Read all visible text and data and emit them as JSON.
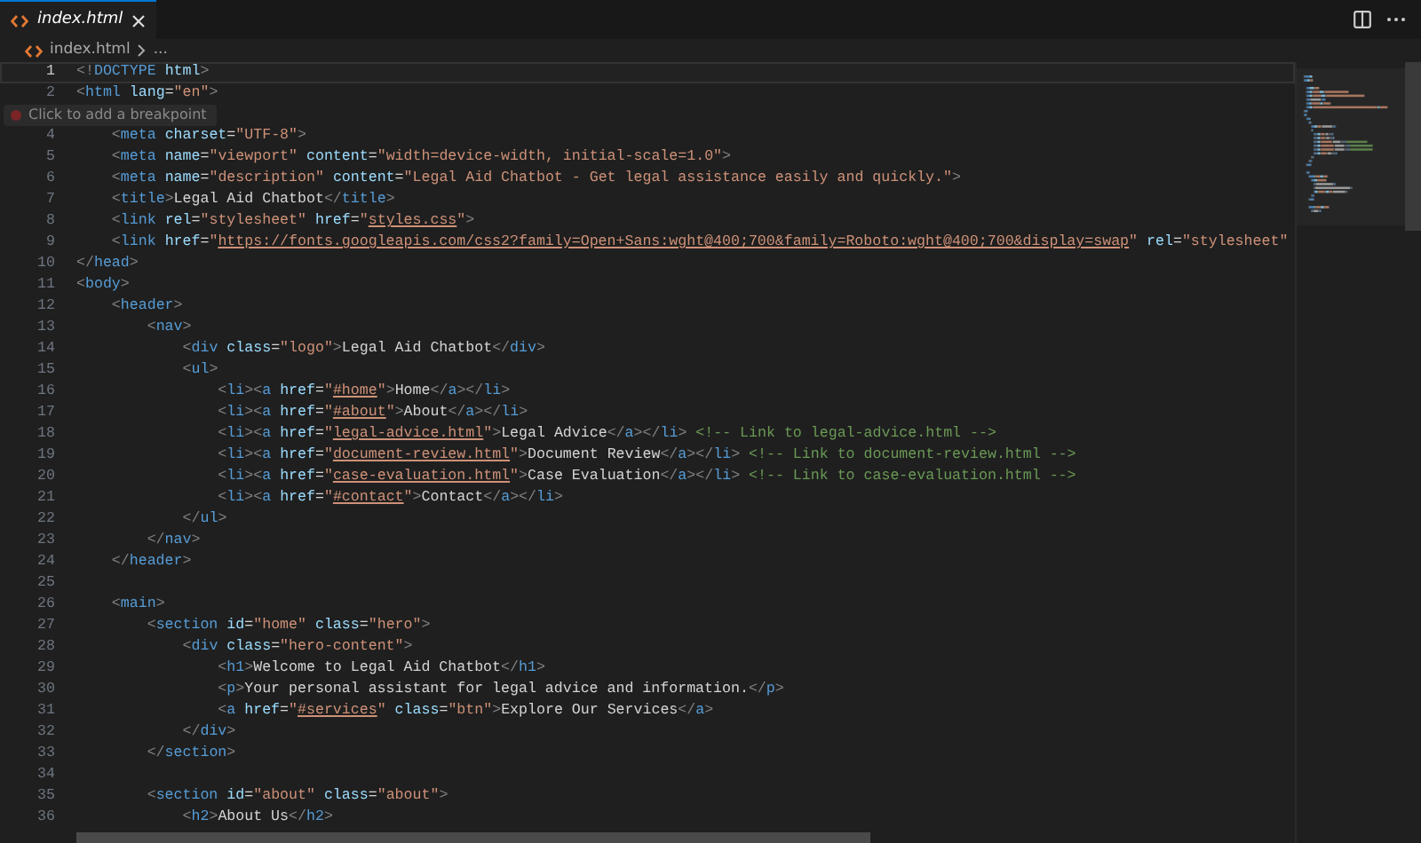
{
  "tabs": [
    {
      "label": "index.html",
      "selected": true
    }
  ],
  "breadcrumb": {
    "file": "index.html",
    "more": "..."
  },
  "editor": {
    "lines": [
      {
        "number": "1",
        "current": true,
        "tokens": [
          {
            "kind": "p",
            "text": "<!"
          },
          {
            "kind": "t",
            "text": "DOCTYPE "
          },
          {
            "kind": "a",
            "text": "html"
          },
          {
            "kind": "p",
            "text": ">"
          }
        ]
      },
      {
        "number": "2",
        "current": false,
        "tokens": [
          {
            "kind": "p",
            "text": "<"
          },
          {
            "kind": "t",
            "text": "html "
          },
          {
            "kind": "a",
            "text": "lang"
          },
          {
            "kind": "x",
            "text": "="
          },
          {
            "kind": "s",
            "text": "\"en\""
          },
          {
            "kind": "p",
            "text": ">"
          }
        ]
      },
      {
        "tooltip": "Click to add a breakpoint",
        "current": false
      },
      {
        "number": "4",
        "current": false,
        "tokens": [
          {
            "kind": "p",
            "text": "    <"
          },
          {
            "kind": "t",
            "text": "meta "
          },
          {
            "kind": "a",
            "text": "charset"
          },
          {
            "kind": "x",
            "text": "="
          },
          {
            "kind": "s",
            "text": "\"UTF-8\""
          },
          {
            "kind": "p",
            "text": ">"
          }
        ]
      },
      {
        "number": "5",
        "current": false,
        "tokens": [
          {
            "kind": "p",
            "text": "    <"
          },
          {
            "kind": "t",
            "text": "meta "
          },
          {
            "kind": "a",
            "text": "name"
          },
          {
            "kind": "x",
            "text": "="
          },
          {
            "kind": "s",
            "text": "\"viewport\" "
          },
          {
            "kind": "a",
            "text": "content"
          },
          {
            "kind": "x",
            "text": "="
          },
          {
            "kind": "s",
            "text": "\"width=device-width, initial-scale=1.0\""
          },
          {
            "kind": "p",
            "text": ">"
          }
        ]
      },
      {
        "number": "6",
        "current": false,
        "tokens": [
          {
            "kind": "p",
            "text": "    <"
          },
          {
            "kind": "t",
            "text": "meta "
          },
          {
            "kind": "a",
            "text": "name"
          },
          {
            "kind": "x",
            "text": "="
          },
          {
            "kind": "s",
            "text": "\"description\" "
          },
          {
            "kind": "a",
            "text": "content"
          },
          {
            "kind": "x",
            "text": "="
          },
          {
            "kind": "s",
            "text": "\"Legal Aid Chatbot - Get legal assistance easily and quickly.\""
          },
          {
            "kind": "p",
            "text": ">"
          }
        ]
      },
      {
        "number": "7",
        "current": false,
        "tokens": [
          {
            "kind": "p",
            "text": "    <"
          },
          {
            "kind": "t",
            "text": "title"
          },
          {
            "kind": "p",
            "text": ">"
          },
          {
            "kind": "x",
            "text": "Legal Aid Chatbot"
          },
          {
            "kind": "p",
            "text": "</"
          },
          {
            "kind": "t",
            "text": "title"
          },
          {
            "kind": "p",
            "text": ">"
          }
        ]
      },
      {
        "number": "8",
        "current": false,
        "tokens": [
          {
            "kind": "p",
            "text": "    <"
          },
          {
            "kind": "t",
            "text": "link "
          },
          {
            "kind": "a",
            "text": "rel"
          },
          {
            "kind": "x",
            "text": "="
          },
          {
            "kind": "s",
            "text": "\"stylesheet\" "
          },
          {
            "kind": "a",
            "text": "href"
          },
          {
            "kind": "x",
            "text": "="
          },
          {
            "kind": "s",
            "text": "\""
          },
          {
            "kind": "l",
            "text": "styles.css"
          },
          {
            "kind": "s",
            "text": "\""
          },
          {
            "kind": "p",
            "text": ">"
          }
        ]
      },
      {
        "number": "9",
        "current": false,
        "tokens": [
          {
            "kind": "p",
            "text": "    <"
          },
          {
            "kind": "t",
            "text": "link "
          },
          {
            "kind": "a",
            "text": "href"
          },
          {
            "kind": "x",
            "text": "="
          },
          {
            "kind": "s",
            "text": "\""
          },
          {
            "kind": "l",
            "text": "https://fonts.googleapis.com/css2?family=Open+Sans:wght@400;700&family=Roboto:wght@400;700&display=swap"
          },
          {
            "kind": "s",
            "text": "\" "
          },
          {
            "kind": "a",
            "text": "rel"
          },
          {
            "kind": "x",
            "text": "="
          },
          {
            "kind": "s",
            "text": "\"stylesheet\""
          }
        ]
      },
      {
        "number": "10",
        "current": false,
        "tokens": [
          {
            "kind": "p",
            "text": "</"
          },
          {
            "kind": "t",
            "text": "head"
          },
          {
            "kind": "p",
            "text": ">"
          }
        ]
      },
      {
        "number": "11",
        "current": false,
        "tokens": [
          {
            "kind": "p",
            "text": "<"
          },
          {
            "kind": "t",
            "text": "body"
          },
          {
            "kind": "p",
            "text": ">"
          }
        ]
      },
      {
        "number": "12",
        "current": false,
        "tokens": [
          {
            "kind": "p",
            "text": "    <"
          },
          {
            "kind": "t",
            "text": "header"
          },
          {
            "kind": "p",
            "text": ">"
          }
        ]
      },
      {
        "number": "13",
        "current": false,
        "tokens": [
          {
            "kind": "p",
            "text": "        <"
          },
          {
            "kind": "t",
            "text": "nav"
          },
          {
            "kind": "p",
            "text": ">"
          }
        ]
      },
      {
        "number": "14",
        "current": false,
        "tokens": [
          {
            "kind": "p",
            "text": "            <"
          },
          {
            "kind": "t",
            "text": "div "
          },
          {
            "kind": "a",
            "text": "class"
          },
          {
            "kind": "x",
            "text": "="
          },
          {
            "kind": "s",
            "text": "\"logo\""
          },
          {
            "kind": "p",
            "text": ">"
          },
          {
            "kind": "x",
            "text": "Legal Aid Chatbot"
          },
          {
            "kind": "p",
            "text": "</"
          },
          {
            "kind": "t",
            "text": "div"
          },
          {
            "kind": "p",
            "text": ">"
          }
        ]
      },
      {
        "number": "15",
        "current": false,
        "tokens": [
          {
            "kind": "p",
            "text": "            <"
          },
          {
            "kind": "t",
            "text": "ul"
          },
          {
            "kind": "p",
            "text": ">"
          }
        ]
      },
      {
        "number": "16",
        "current": false,
        "tokens": [
          {
            "kind": "p",
            "text": "                <"
          },
          {
            "kind": "t",
            "text": "li"
          },
          {
            "kind": "p",
            "text": "><"
          },
          {
            "kind": "t",
            "text": "a "
          },
          {
            "kind": "a",
            "text": "href"
          },
          {
            "kind": "x",
            "text": "="
          },
          {
            "kind": "s",
            "text": "\""
          },
          {
            "kind": "l",
            "text": "#home"
          },
          {
            "kind": "s",
            "text": "\""
          },
          {
            "kind": "p",
            "text": ">"
          },
          {
            "kind": "x",
            "text": "Home"
          },
          {
            "kind": "p",
            "text": "</"
          },
          {
            "kind": "t",
            "text": "a"
          },
          {
            "kind": "p",
            "text": "></"
          },
          {
            "kind": "t",
            "text": "li"
          },
          {
            "kind": "p",
            "text": ">"
          }
        ]
      },
      {
        "number": "17",
        "current": false,
        "tokens": [
          {
            "kind": "p",
            "text": "                <"
          },
          {
            "kind": "t",
            "text": "li"
          },
          {
            "kind": "p",
            "text": "><"
          },
          {
            "kind": "t",
            "text": "a "
          },
          {
            "kind": "a",
            "text": "href"
          },
          {
            "kind": "x",
            "text": "="
          },
          {
            "kind": "s",
            "text": "\""
          },
          {
            "kind": "l",
            "text": "#about"
          },
          {
            "kind": "s",
            "text": "\""
          },
          {
            "kind": "p",
            "text": ">"
          },
          {
            "kind": "x",
            "text": "About"
          },
          {
            "kind": "p",
            "text": "</"
          },
          {
            "kind": "t",
            "text": "a"
          },
          {
            "kind": "p",
            "text": "></"
          },
          {
            "kind": "t",
            "text": "li"
          },
          {
            "kind": "p",
            "text": ">"
          }
        ]
      },
      {
        "number": "18",
        "current": false,
        "tokens": [
          {
            "kind": "p",
            "text": "                <"
          },
          {
            "kind": "t",
            "text": "li"
          },
          {
            "kind": "p",
            "text": "><"
          },
          {
            "kind": "t",
            "text": "a "
          },
          {
            "kind": "a",
            "text": "href"
          },
          {
            "kind": "x",
            "text": "="
          },
          {
            "kind": "s",
            "text": "\""
          },
          {
            "kind": "l",
            "text": "legal-advice.html"
          },
          {
            "kind": "s",
            "text": "\""
          },
          {
            "kind": "p",
            "text": ">"
          },
          {
            "kind": "x",
            "text": "Legal Advice"
          },
          {
            "kind": "p",
            "text": "</"
          },
          {
            "kind": "t",
            "text": "a"
          },
          {
            "kind": "p",
            "text": "></"
          },
          {
            "kind": "t",
            "text": "li"
          },
          {
            "kind": "p",
            "text": "> "
          },
          {
            "kind": "c",
            "text": "<!-- Link to legal-advice.html -->"
          }
        ]
      },
      {
        "number": "19",
        "current": false,
        "tokens": [
          {
            "kind": "p",
            "text": "                <"
          },
          {
            "kind": "t",
            "text": "li"
          },
          {
            "kind": "p",
            "text": "><"
          },
          {
            "kind": "t",
            "text": "a "
          },
          {
            "kind": "a",
            "text": "href"
          },
          {
            "kind": "x",
            "text": "="
          },
          {
            "kind": "s",
            "text": "\""
          },
          {
            "kind": "l",
            "text": "document-review.html"
          },
          {
            "kind": "s",
            "text": "\""
          },
          {
            "kind": "p",
            "text": ">"
          },
          {
            "kind": "x",
            "text": "Document Review"
          },
          {
            "kind": "p",
            "text": "</"
          },
          {
            "kind": "t",
            "text": "a"
          },
          {
            "kind": "p",
            "text": "></"
          },
          {
            "kind": "t",
            "text": "li"
          },
          {
            "kind": "p",
            "text": "> "
          },
          {
            "kind": "c",
            "text": "<!-- Link to document-review.html -->"
          }
        ]
      },
      {
        "number": "20",
        "current": false,
        "tokens": [
          {
            "kind": "p",
            "text": "                <"
          },
          {
            "kind": "t",
            "text": "li"
          },
          {
            "kind": "p",
            "text": "><"
          },
          {
            "kind": "t",
            "text": "a "
          },
          {
            "kind": "a",
            "text": "href"
          },
          {
            "kind": "x",
            "text": "="
          },
          {
            "kind": "s",
            "text": "\""
          },
          {
            "kind": "l",
            "text": "case-evaluation.html"
          },
          {
            "kind": "s",
            "text": "\""
          },
          {
            "kind": "p",
            "text": ">"
          },
          {
            "kind": "x",
            "text": "Case Evaluation"
          },
          {
            "kind": "p",
            "text": "</"
          },
          {
            "kind": "t",
            "text": "a"
          },
          {
            "kind": "p",
            "text": "></"
          },
          {
            "kind": "t",
            "text": "li"
          },
          {
            "kind": "p",
            "text": "> "
          },
          {
            "kind": "c",
            "text": "<!-- Link to case-evaluation.html -->"
          }
        ]
      },
      {
        "number": "21",
        "current": false,
        "tokens": [
          {
            "kind": "p",
            "text": "                <"
          },
          {
            "kind": "t",
            "text": "li"
          },
          {
            "kind": "p",
            "text": "><"
          },
          {
            "kind": "t",
            "text": "a "
          },
          {
            "kind": "a",
            "text": "href"
          },
          {
            "kind": "x",
            "text": "="
          },
          {
            "kind": "s",
            "text": "\""
          },
          {
            "kind": "l",
            "text": "#contact"
          },
          {
            "kind": "s",
            "text": "\""
          },
          {
            "kind": "p",
            "text": ">"
          },
          {
            "kind": "x",
            "text": "Contact"
          },
          {
            "kind": "p",
            "text": "</"
          },
          {
            "kind": "t",
            "text": "a"
          },
          {
            "kind": "p",
            "text": "></"
          },
          {
            "kind": "t",
            "text": "li"
          },
          {
            "kind": "p",
            "text": ">"
          }
        ]
      },
      {
        "number": "22",
        "current": false,
        "tokens": [
          {
            "kind": "p",
            "text": "            </"
          },
          {
            "kind": "t",
            "text": "ul"
          },
          {
            "kind": "p",
            "text": ">"
          }
        ]
      },
      {
        "number": "23",
        "current": false,
        "tokens": [
          {
            "kind": "p",
            "text": "        </"
          },
          {
            "kind": "t",
            "text": "nav"
          },
          {
            "kind": "p",
            "text": ">"
          }
        ]
      },
      {
        "number": "24",
        "current": false,
        "tokens": [
          {
            "kind": "p",
            "text": "    </"
          },
          {
            "kind": "t",
            "text": "header"
          },
          {
            "kind": "p",
            "text": ">"
          }
        ]
      },
      {
        "number": "25",
        "current": false
      },
      {
        "number": "26",
        "current": false,
        "tokens": [
          {
            "kind": "p",
            "text": "    <"
          },
          {
            "kind": "t",
            "text": "main"
          },
          {
            "kind": "p",
            "text": ">"
          }
        ]
      },
      {
        "number": "27",
        "current": false,
        "tokens": [
          {
            "kind": "p",
            "text": "        <"
          },
          {
            "kind": "t",
            "text": "section "
          },
          {
            "kind": "a",
            "text": "id"
          },
          {
            "kind": "x",
            "text": "="
          },
          {
            "kind": "s",
            "text": "\"home\" "
          },
          {
            "kind": "a",
            "text": "class"
          },
          {
            "kind": "x",
            "text": "="
          },
          {
            "kind": "s",
            "text": "\"hero\""
          },
          {
            "kind": "p",
            "text": ">"
          }
        ]
      },
      {
        "number": "28",
        "current": false,
        "tokens": [
          {
            "kind": "p",
            "text": "            <"
          },
          {
            "kind": "t",
            "text": "div "
          },
          {
            "kind": "a",
            "text": "class"
          },
          {
            "kind": "x",
            "text": "="
          },
          {
            "kind": "s",
            "text": "\"hero-content\""
          },
          {
            "kind": "p",
            "text": ">"
          }
        ]
      },
      {
        "number": "29",
        "current": false,
        "tokens": [
          {
            "kind": "p",
            "text": "                <"
          },
          {
            "kind": "t",
            "text": "h1"
          },
          {
            "kind": "p",
            "text": ">"
          },
          {
            "kind": "x",
            "text": "Welcome to Legal Aid Chatbot"
          },
          {
            "kind": "p",
            "text": "</"
          },
          {
            "kind": "t",
            "text": "h1"
          },
          {
            "kind": "p",
            "text": ">"
          }
        ]
      },
      {
        "number": "30",
        "current": false,
        "tokens": [
          {
            "kind": "p",
            "text": "                <"
          },
          {
            "kind": "t",
            "text": "p"
          },
          {
            "kind": "p",
            "text": ">"
          },
          {
            "kind": "x",
            "text": "Your personal assistant for legal advice and information."
          },
          {
            "kind": "p",
            "text": "</"
          },
          {
            "kind": "t",
            "text": "p"
          },
          {
            "kind": "p",
            "text": ">"
          }
        ]
      },
      {
        "number": "31",
        "current": false,
        "tokens": [
          {
            "kind": "p",
            "text": "                <"
          },
          {
            "kind": "t",
            "text": "a "
          },
          {
            "kind": "a",
            "text": "href"
          },
          {
            "kind": "x",
            "text": "="
          },
          {
            "kind": "s",
            "text": "\""
          },
          {
            "kind": "l",
            "text": "#services"
          },
          {
            "kind": "s",
            "text": "\" "
          },
          {
            "kind": "a",
            "text": "class"
          },
          {
            "kind": "x",
            "text": "="
          },
          {
            "kind": "s",
            "text": "\"btn\""
          },
          {
            "kind": "p",
            "text": ">"
          },
          {
            "kind": "x",
            "text": "Explore Our Services"
          },
          {
            "kind": "p",
            "text": "</"
          },
          {
            "kind": "t",
            "text": "a"
          },
          {
            "kind": "p",
            "text": ">"
          }
        ]
      },
      {
        "number": "32",
        "current": false,
        "tokens": [
          {
            "kind": "p",
            "text": "            </"
          },
          {
            "kind": "t",
            "text": "div"
          },
          {
            "kind": "p",
            "text": ">"
          }
        ]
      },
      {
        "number": "33",
        "current": false,
        "tokens": [
          {
            "kind": "p",
            "text": "        </"
          },
          {
            "kind": "t",
            "text": "section"
          },
          {
            "kind": "p",
            "text": ">"
          }
        ]
      },
      {
        "number": "34",
        "current": false
      },
      {
        "number": "35",
        "current": false,
        "tokens": [
          {
            "kind": "p",
            "text": "        <"
          },
          {
            "kind": "t",
            "text": "section "
          },
          {
            "kind": "a",
            "text": "id"
          },
          {
            "kind": "x",
            "text": "="
          },
          {
            "kind": "s",
            "text": "\"about\" "
          },
          {
            "kind": "a",
            "text": "class"
          },
          {
            "kind": "x",
            "text": "="
          },
          {
            "kind": "s",
            "text": "\"about\""
          },
          {
            "kind": "p",
            "text": ">"
          }
        ]
      },
      {
        "number": "36",
        "current": false,
        "tokens": [
          {
            "kind": "p",
            "text": "            <"
          },
          {
            "kind": "t",
            "text": "h2"
          },
          {
            "kind": "p",
            "text": ">"
          },
          {
            "kind": "x",
            "text": "About Us"
          },
          {
            "kind": "p",
            "text": "</"
          },
          {
            "kind": "t",
            "text": "h2"
          },
          {
            "kind": "p",
            "text": ">"
          }
        ]
      }
    ]
  }
}
